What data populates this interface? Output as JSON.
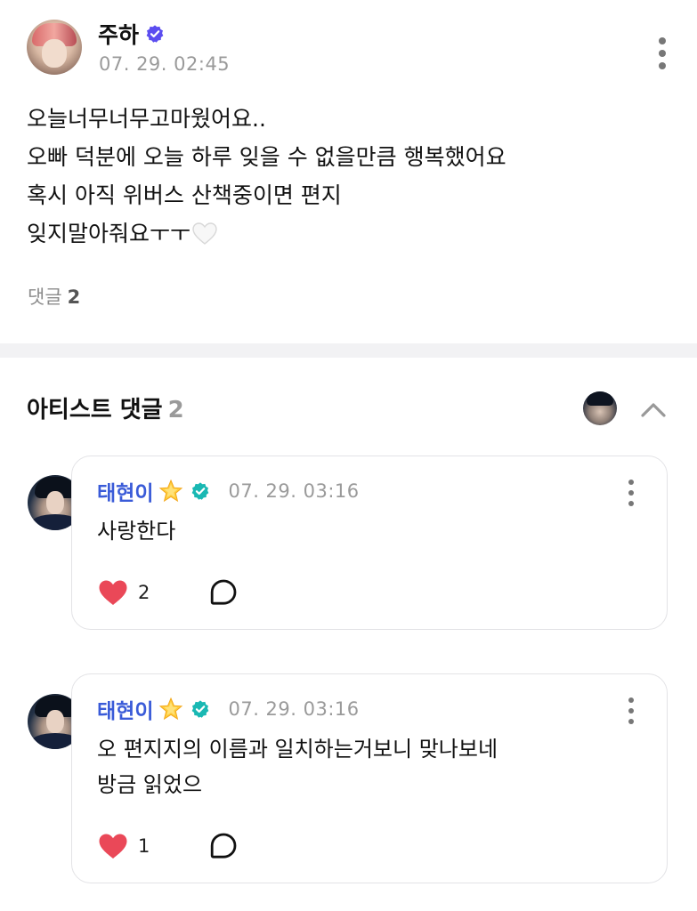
{
  "post": {
    "author": "주하",
    "time": "07. 29. 02:45",
    "body_lines": [
      "오늘너무너무고마웠어요..",
      "오빠 덕분에 오늘 하루 잊을 수 없을만큼 행복했어요",
      "혹시 아직 위버스 산책중이면 편지",
      "잊지말아줘요ㅜㅜ"
    ],
    "comments_label": "댓글",
    "comments_count": "2"
  },
  "artist_comments": {
    "title": "아티스트 댓글",
    "count": "2"
  },
  "comments": [
    {
      "author": "태현이",
      "time": "07. 29. 03:16",
      "lines": [
        "사랑한다"
      ],
      "likes": "2"
    },
    {
      "author": "태현이",
      "time": "07. 29. 03:16",
      "lines": [
        "오 편지지의 이름과 일치하는거보니 맞나보네",
        "방금 읽었으"
      ],
      "likes": "1"
    }
  ],
  "icons": {
    "verified": "verified-badge-icon",
    "star": "star-icon",
    "heart": "heart-icon",
    "reply": "reply-bubble-icon",
    "more": "more-vertical-icon",
    "chevron": "chevron-up-icon"
  },
  "colors": {
    "artist_name": "#3a5bd8",
    "like_heart": "#ea4858",
    "verified_badge": "#5b4df0",
    "artist_badge": "#19b8b3",
    "muted_text": "#9a9a9a"
  }
}
